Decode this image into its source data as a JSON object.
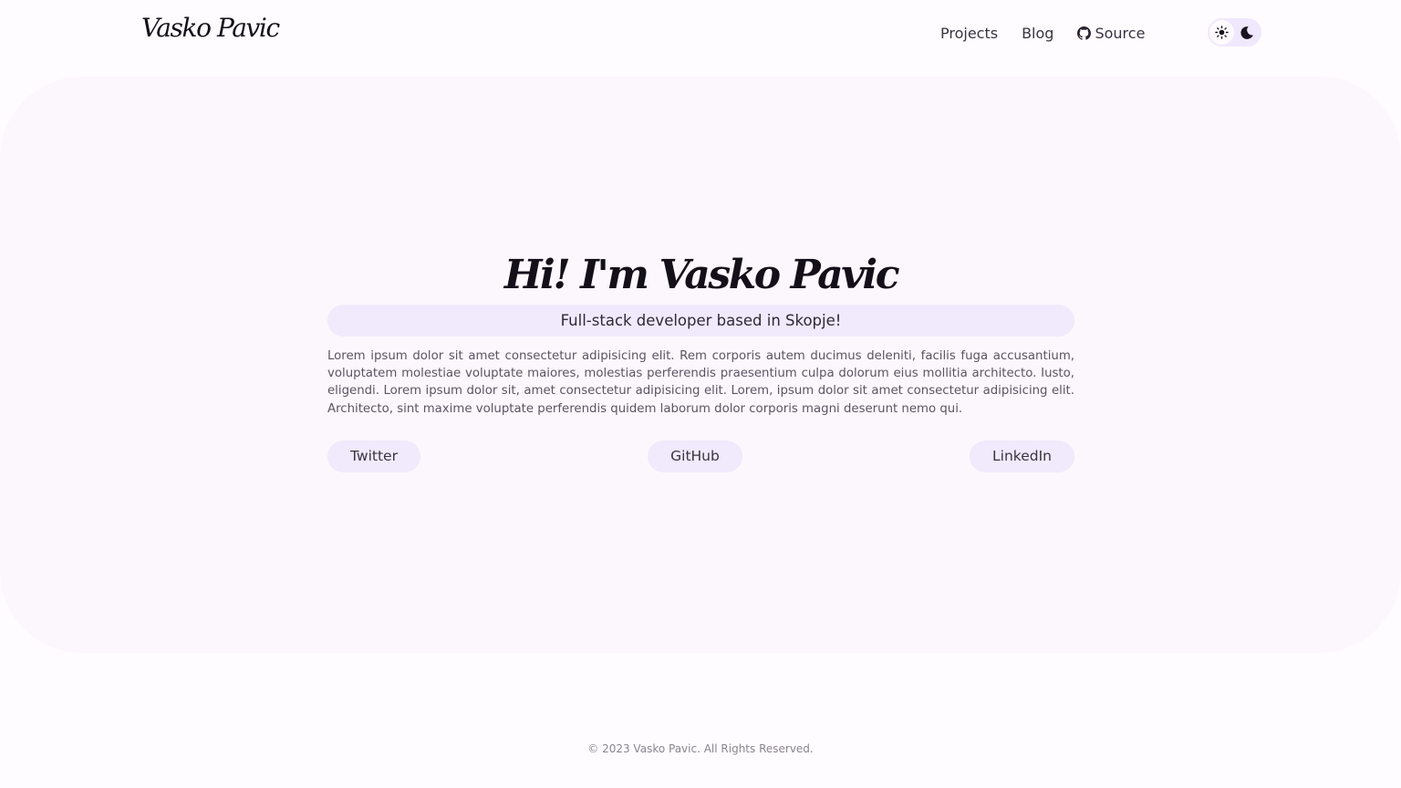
{
  "header": {
    "logo": "Vasko Pavic",
    "nav": [
      {
        "label": "Projects"
      },
      {
        "label": "Blog"
      },
      {
        "label": "Source",
        "icon": "github-icon"
      }
    ],
    "theme_toggle": {
      "options": [
        "sun-icon",
        "moon-icon"
      ],
      "active": "light"
    }
  },
  "hero": {
    "title": "Hi! I'm Vasko Pavic",
    "subtitle": "Full-stack developer based in Skopje!",
    "bio": "Lorem ipsum dolor sit amet consectetur adipisicing elit. Rem corporis autem ducimus deleniti, facilis fuga accusantium, voluptatem molestiae voluptate maiores, molestias perferendis praesentium culpa dolorum eius mollitia architecto. Iusto, eligendi. Lorem ipsum dolor sit, amet consectetur adipisicing elit. Lorem, ipsum dolor sit amet consectetur adipisicing elit. Architecto, sint maxime voluptate perferendis quidem laborum dolor corporis magni deserunt nemo qui.",
    "links": [
      {
        "label": "Twitter"
      },
      {
        "label": "GitHub"
      },
      {
        "label": "LinkedIn"
      }
    ]
  },
  "footer": {
    "copyright": "© 2023 Vasko Pavic. All Rights Reserved."
  },
  "colors": {
    "page_bg": "#fefcfe",
    "hero_bg": "#fcf7fc",
    "pill_bg": "#f1e9fc",
    "text_dark": "#14101a"
  }
}
